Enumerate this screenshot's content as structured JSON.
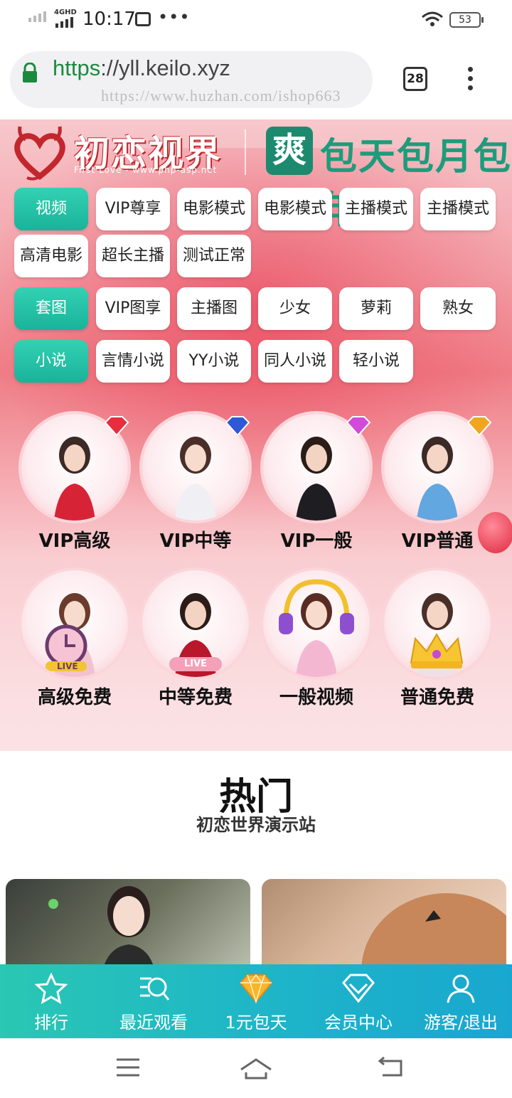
{
  "status_bar": {
    "network": "4GHD",
    "time": "10:17",
    "battery": "53"
  },
  "browser": {
    "url_scheme": "https",
    "url_rest": "://yll.keilo.xyz",
    "watermark": "https://www.huzhan.com/ishop663",
    "tab_count": "28"
  },
  "banner": {
    "brand": "初恋视界",
    "brand_sub": "First Love - www.php-asp.net",
    "app_icon_char": "爽",
    "slogan": "包天包月包年"
  },
  "categories": {
    "video": {
      "label": "视频",
      "items": [
        "VIP尊享",
        "电影模式",
        "电影模式",
        "主播模式",
        "主播模式",
        "高清电影",
        "超长主播",
        "测试正常"
      ]
    },
    "pictures": {
      "label": "套图",
      "items": [
        "VIP图享",
        "主播图",
        "少女",
        "萝莉",
        "熟女"
      ]
    },
    "novels": {
      "label": "小说",
      "items": [
        "言情小说",
        "YY小说",
        "同人小说",
        "轻小说"
      ]
    }
  },
  "vip_tiers": [
    "VIP高级",
    "VIP中等",
    "VIP一般",
    "VIP普通"
  ],
  "free_tiers": [
    "高级免费",
    "中等免费",
    "一般视频",
    "普通免费"
  ],
  "live_badge": "LIVE",
  "hot": {
    "title": "热门",
    "subtitle": "初恋世界演示站"
  },
  "bottom_nav": [
    "排行",
    "最近观看",
    "1元包天",
    "会员中心",
    "游客/退出"
  ],
  "colors": {
    "teal": "#1ab39a",
    "pink": "#ef7d86",
    "gem_red": "#e0293f"
  }
}
